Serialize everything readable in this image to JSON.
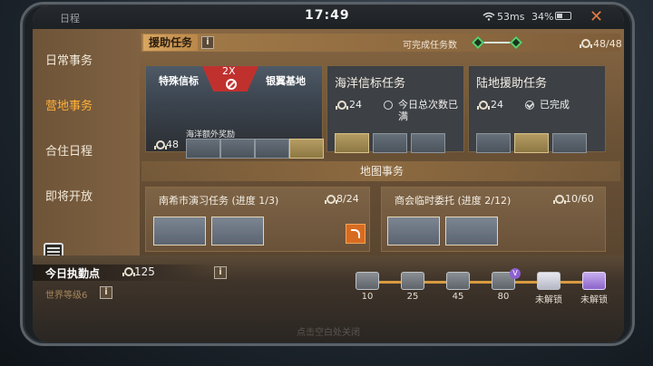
{
  "status_bar": {
    "left_text": "日程",
    "time": "17:49",
    "network": "53ms",
    "battery": "34%"
  },
  "sidebar": {
    "items": [
      {
        "label": "日常事务",
        "active": false
      },
      {
        "label": "营地事务",
        "active": true
      },
      {
        "label": "合住日程",
        "active": false
      },
      {
        "label": "即将开放",
        "active": false
      }
    ]
  },
  "assist": {
    "title": "援助任务",
    "info": "i",
    "completable_label": "可完成任务数",
    "count": "48/48",
    "cards": {
      "special": {
        "left": "特殊信标",
        "right": "银翼基地",
        "multiplier": "2X",
        "extra": "海洋额外奖励",
        "medals": "48"
      },
      "ocean": {
        "title": "海洋信标任务",
        "medals": "24",
        "status": "今日总次数已满"
      },
      "land": {
        "title": "陆地援助任务",
        "medals": "24",
        "status": "已完成"
      }
    }
  },
  "map_affairs": {
    "title": "地图事务",
    "tasks": [
      {
        "title": "南希市演习任务 (进度 1/3)",
        "count": "8/24"
      },
      {
        "title": "商会临时委托 (进度 2/12)",
        "count": "10/60"
      }
    ]
  },
  "daily_duty": {
    "label": "今日执勤点",
    "value": "125",
    "world_level": "世界等级6"
  },
  "rewards": [
    {
      "label": "10"
    },
    {
      "label": "25"
    },
    {
      "label": "45"
    },
    {
      "label": "80"
    },
    {
      "label": "未解锁"
    },
    {
      "label": "未解锁"
    }
  ],
  "footer_hint": "点击空白处关闭",
  "colors": {
    "active_tab": "#ffb13a",
    "complete": "#58d06a",
    "banner_red": "#c0312e"
  }
}
